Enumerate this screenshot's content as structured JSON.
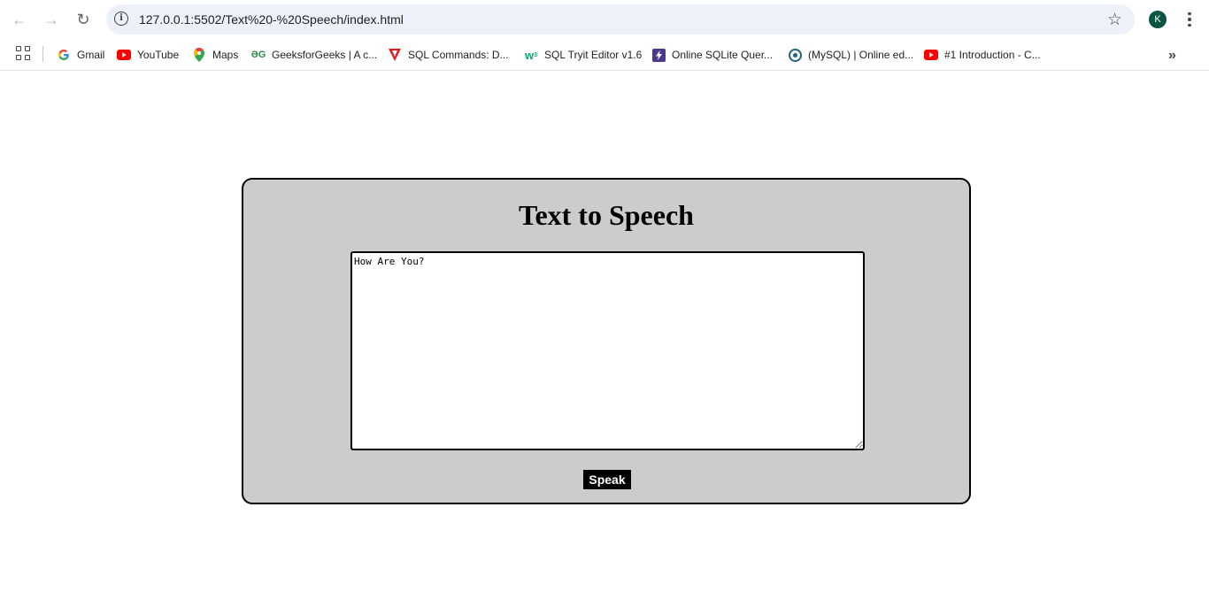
{
  "browser": {
    "url": "127.0.0.1:5502/Text%20-%20Speech/index.html",
    "profile_initial": "K",
    "bookmarks": [
      {
        "label": "Gmail",
        "icon": "google-icon"
      },
      {
        "label": "YouTube",
        "icon": "youtube-icon"
      },
      {
        "label": "Maps",
        "icon": "maps-icon"
      },
      {
        "label": "GeeksforGeeks | A c...",
        "icon": "geeksforgeeks-icon"
      },
      {
        "label": "SQL Commands: D...",
        "icon": "red-v-icon"
      },
      {
        "label": "SQL Tryit Editor v1.6",
        "icon": "w3schools-icon"
      },
      {
        "label": "Online SQLite Quer...",
        "icon": "lightning-icon"
      },
      {
        "label": "(MySQL) | Online ed...",
        "icon": "onecompiler-icon"
      },
      {
        "label": "#1 Introduction - C...",
        "icon": "youtube-icon"
      }
    ]
  },
  "page": {
    "title": "Text to Speech",
    "textarea_value": "How Are You?",
    "speak_label": "Speak"
  },
  "colors": {
    "card_background": "#cccccc",
    "button_background": "#000000",
    "omnibox_background": "#edf1f9",
    "avatar_background": "#0b5545"
  }
}
